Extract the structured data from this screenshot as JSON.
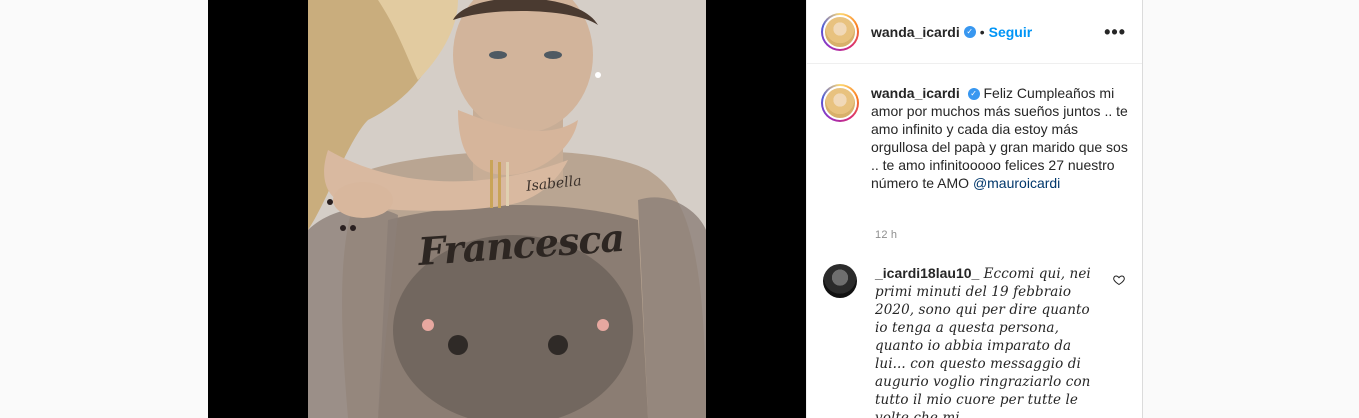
{
  "post": {
    "image_alt": "photo",
    "tattoo_wrist": "Isabella",
    "tattoo_chest": "Francesca"
  },
  "header": {
    "username": "wanda_icardi",
    "separator": "•",
    "follow_label": "Seguir",
    "more_icon": "more-icon"
  },
  "caption": {
    "username": "wanda_icardi",
    "text": "Feliz Cumpleaños mi amor por muchos más sueños juntos .. te amo infinito y cada dia estoy más orgullosa del papà y gran marido que sos .. te amo infinitooooo felices 27 nuestro número te AMO",
    "mention": "@mauroicardi",
    "time": "12 h"
  },
  "comment": {
    "username": "_icardi18lau10_",
    "text": "Eccomi qui, nei primi minuti del 19 febbraio 2020, sono qui per dire quanto io tenga a questa persona, quanto io abbia imparato da lui... con questo messaggio di augurio voglio ringraziarlo con tutto il mio cuore per tutte le volte che mi"
  },
  "colors": {
    "accent": "#0095f6",
    "verified": "#3897f0",
    "text": "#262626",
    "muted": "#8e8e8e",
    "mention": "#00376b"
  }
}
